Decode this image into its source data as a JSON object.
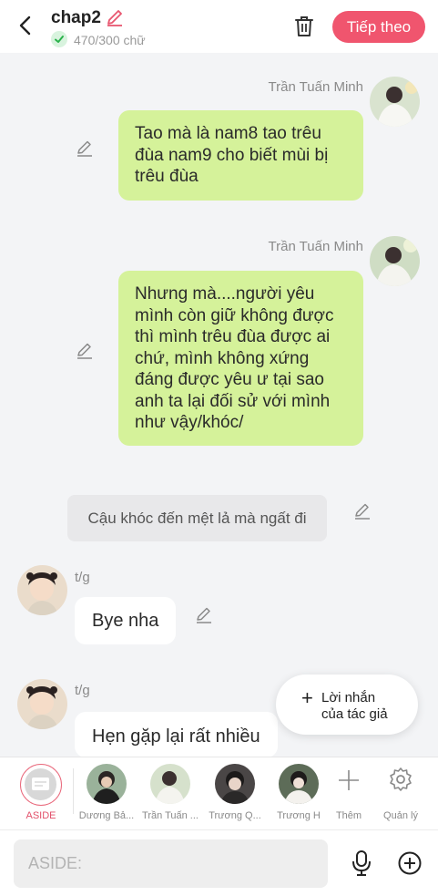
{
  "header": {
    "title": "chap2",
    "word_count": "470/300 chữ",
    "next_label": "Tiếp theo"
  },
  "messages": [
    {
      "kind": "right",
      "author": "Trần Tuấn Minh",
      "text": "Tao mà là nam8 tao trêu đùa nam9 cho biết mùi bị trêu đùa"
    },
    {
      "kind": "right",
      "author": "Trần Tuấn Minh",
      "text": "Nhưng mà....người yêu mình còn giữ không được thì mình trêu đùa được ai chứ, mình không xứng đáng được yêu ư tại sao anh ta lại đối sử với mình như vậy/khóc/"
    },
    {
      "kind": "narration",
      "text": "Cậu khóc đến mệt lả mà ngất đi"
    },
    {
      "kind": "left",
      "author": "t/g",
      "text": "Bye nha"
    },
    {
      "kind": "left",
      "author": "t/g",
      "text": "Hẹn gặp lại rất nhiều"
    }
  ],
  "author_note": {
    "label_line1": "Lời nhắn",
    "label_line2": "của tác giả"
  },
  "characters": {
    "aside_label": "ASIDE",
    "items": [
      {
        "label": "Dương Bả..."
      },
      {
        "label": "Trần Tuấn ..."
      },
      {
        "label": "Trương Q..."
      },
      {
        "label": "Trương H"
      }
    ],
    "add_label": "Thêm",
    "manage_label": "Quản lý"
  },
  "input": {
    "placeholder": "ASIDE:"
  },
  "colors": {
    "accent": "#f0556e",
    "bubble_green": "#d5f29a",
    "background": "#f3f4f6"
  }
}
